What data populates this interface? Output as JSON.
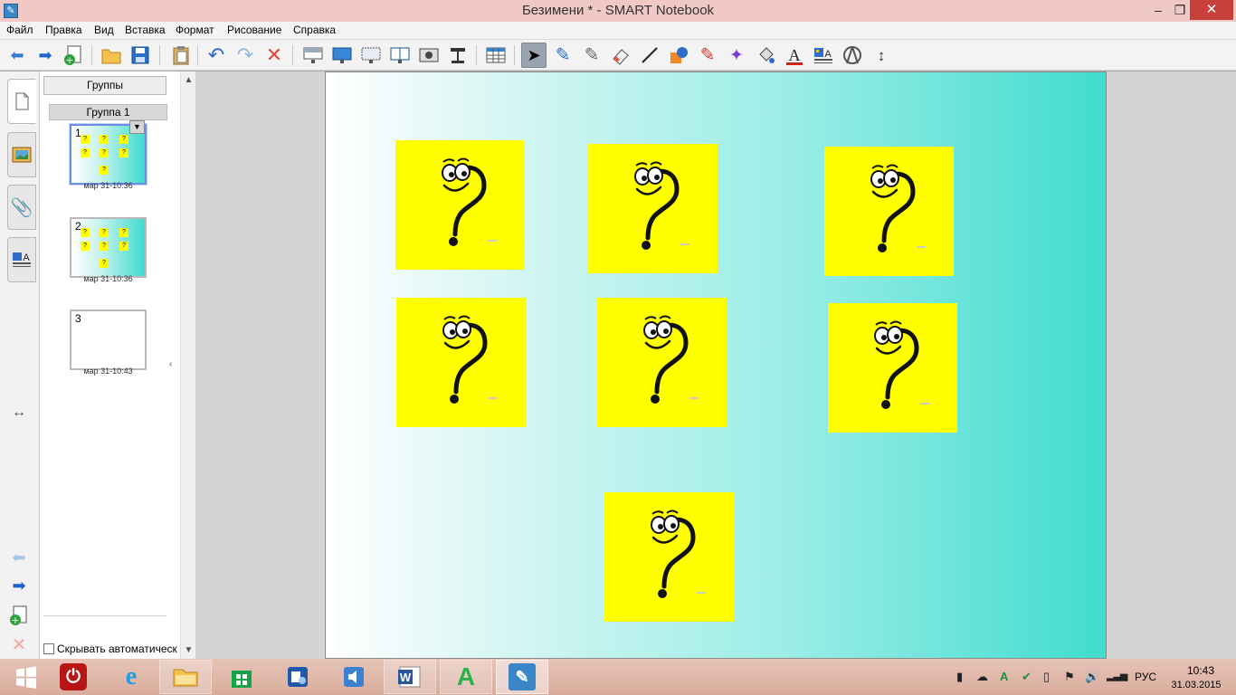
{
  "window": {
    "title": "Безимени * - SMART Notebook",
    "app_icon": "notebook-icon",
    "min_glyph": "–",
    "max_glyph": "❐",
    "close_glyph": "✕"
  },
  "menu": {
    "file": "Файл",
    "edit": "Правка",
    "view": "Вид",
    "insert": "Вставка",
    "format": "Формат",
    "draw": "Рисование",
    "help": "Справка"
  },
  "toolbar": {
    "icons": [
      "back-icon",
      "forward-icon",
      "add-page-icon",
      "open-icon",
      "save-icon",
      "paste-icon",
      "undo-icon",
      "redo-icon",
      "delete-icon",
      "screen-shade-icon",
      "full-screen-icon",
      "transparent-bg-icon",
      "dual-page-icon",
      "capture-icon",
      "doc-camera-icon",
      "table-icon",
      "select-icon",
      "pen-icon",
      "creative-pen-icon",
      "eraser-icon",
      "line-icon",
      "shapes-icon",
      "shape-pen-icon",
      "magic-pen-icon",
      "fill-icon",
      "text-icon",
      "properties-icon",
      "measurement-icon",
      "move-toolbar-icon"
    ]
  },
  "sidebar": {
    "tabs": [
      "page-sorter-tab",
      "gallery-tab",
      "attachments-tab",
      "properties-tab"
    ],
    "groups_button": "Группы",
    "group_name": "Группа 1",
    "pages": [
      {
        "number": "1",
        "time": "мар 31-10:36"
      },
      {
        "number": "2",
        "time": "мар 31-10:36"
      },
      {
        "number": "3",
        "time": "мар 31-10:43"
      }
    ],
    "resize_glyph": "‹",
    "autohide_label": "Скрывать автоматическ",
    "strip_arrows": "↔"
  },
  "canvas": {
    "card_count": 7,
    "card_color": "#ffff00",
    "background": [
      "#ffffff",
      "#40dccf"
    ]
  },
  "taskbar": {
    "apps": [
      "start-icon",
      "shutdown-icon",
      "internet-explorer-icon",
      "file-explorer-icon",
      "windows-store-icon",
      "control-panel-icon",
      "speaker-app-icon",
      "word-icon",
      "green-a-app-icon",
      "smart-notebook-icon"
    ],
    "language": "РУС",
    "time": "10:43",
    "date": "31.03.2015"
  }
}
